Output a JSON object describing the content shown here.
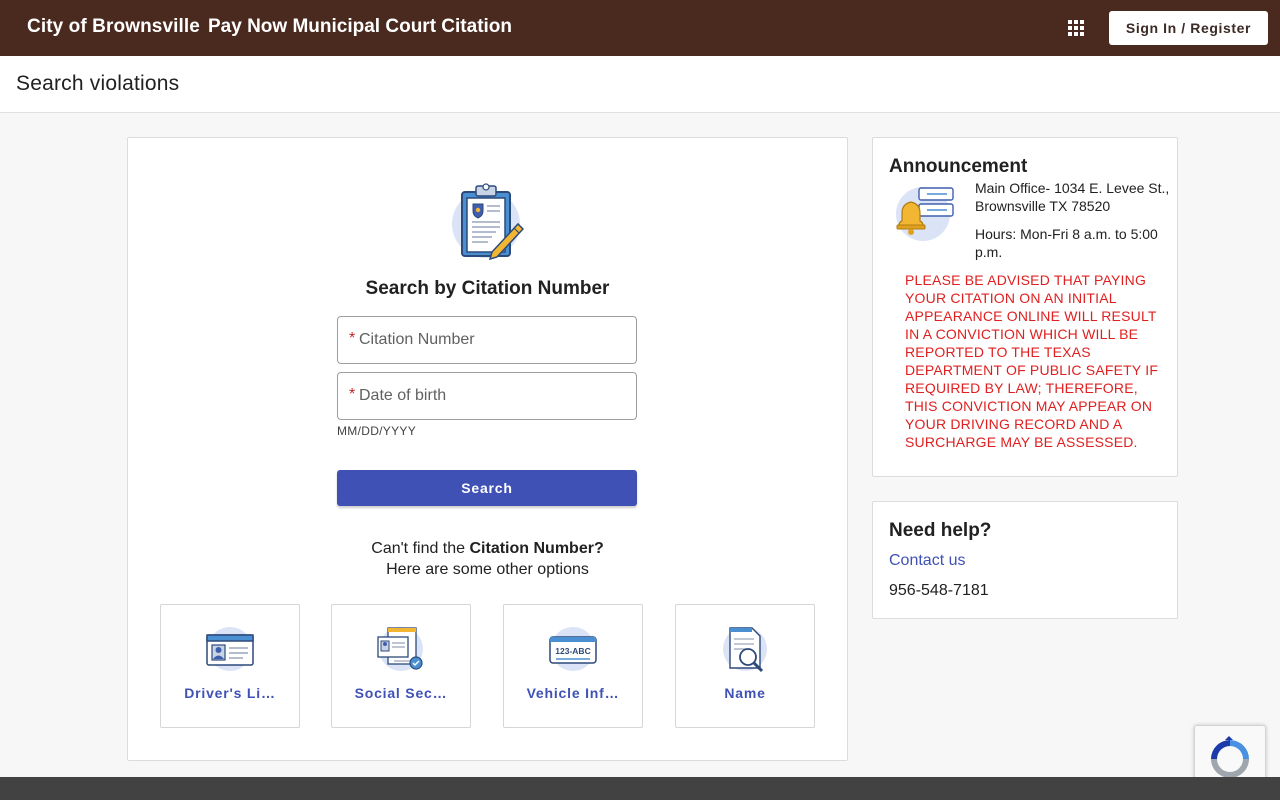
{
  "header": {
    "brand": "City of Brownsville",
    "app_title": "Pay Now Municipal Court Citation",
    "signin_label": "Sign In / Register",
    "apps_icon": "apps-grid-icon"
  },
  "page": {
    "title": "Search violations"
  },
  "search": {
    "title": "Search by Citation Number",
    "citation_placeholder": "Citation Number",
    "citation_value": "",
    "dob_placeholder": "Date of birth",
    "dob_value": "",
    "required_mark": "*",
    "dob_hint": "MM/DD/YYYY",
    "button_label": "Search",
    "cant_find_prefix": "Can't find the ",
    "cant_find_bold": "Citation Number?",
    "cant_find_line2": "Here are some other options"
  },
  "options": [
    {
      "label": "Driver's Li…",
      "icon": "drivers-license-icon"
    },
    {
      "label": "Social Sec…",
      "icon": "social-security-icon"
    },
    {
      "label": "Vehicle Inf…",
      "icon": "vehicle-plate-icon"
    },
    {
      "label": "Name",
      "icon": "name-document-icon"
    }
  ],
  "plate_text": "123-ABC",
  "announcement": {
    "title": "Announcement",
    "address": "Main Office- 1034 E. Levee St., Brownsville TX 78520",
    "hours": "Hours: Mon-Fri 8 a.m. to 5:00 p.m.",
    "warning": "PLEASE BE ADVISED THAT PAYING YOUR CITATION ON AN INITIAL APPEARANCE ONLINE WILL RESULT IN A CONVICTION WHICH WILL BE REPORTED TO THE TEXAS DEPARTMENT OF PUBLIC SAFETY IF REQUIRED BY LAW; THEREFORE, THIS CONVICTION MAY APPEAR ON YOUR DRIVING RECORD AND A SURCHARGE MAY BE ASSESSED."
  },
  "help": {
    "title": "Need help?",
    "contact_label": "Contact us",
    "phone": "956-548-7181"
  },
  "colors": {
    "header_bg": "#4a2a1f",
    "primary": "#3f51b5",
    "warning": "#e02020",
    "footer_bg": "#424242"
  }
}
